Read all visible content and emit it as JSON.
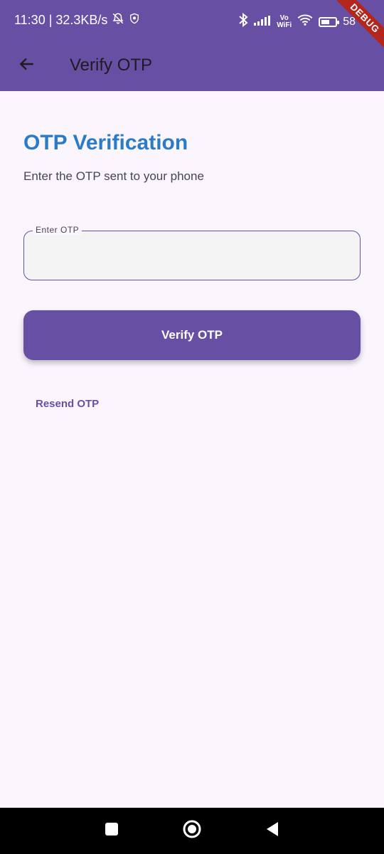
{
  "status_bar": {
    "time_speed": "11:30 | 32.3KB/s",
    "vowifi_top": "Vo",
    "vowifi_bottom": "WiFi",
    "battery_pct": "58"
  },
  "app_bar": {
    "title": "Verify OTP"
  },
  "debug_label": "DEBUG",
  "main": {
    "heading": "OTP Verification",
    "subheading": "Enter the OTP sent to your phone",
    "otp_field": {
      "label": "Enter OTP",
      "value": ""
    },
    "verify_button": "Verify OTP",
    "resend_link": "Resend OTP"
  },
  "colors": {
    "primary": "#6750a4",
    "heading": "#2a7bc8",
    "background": "#fbf5fd"
  }
}
